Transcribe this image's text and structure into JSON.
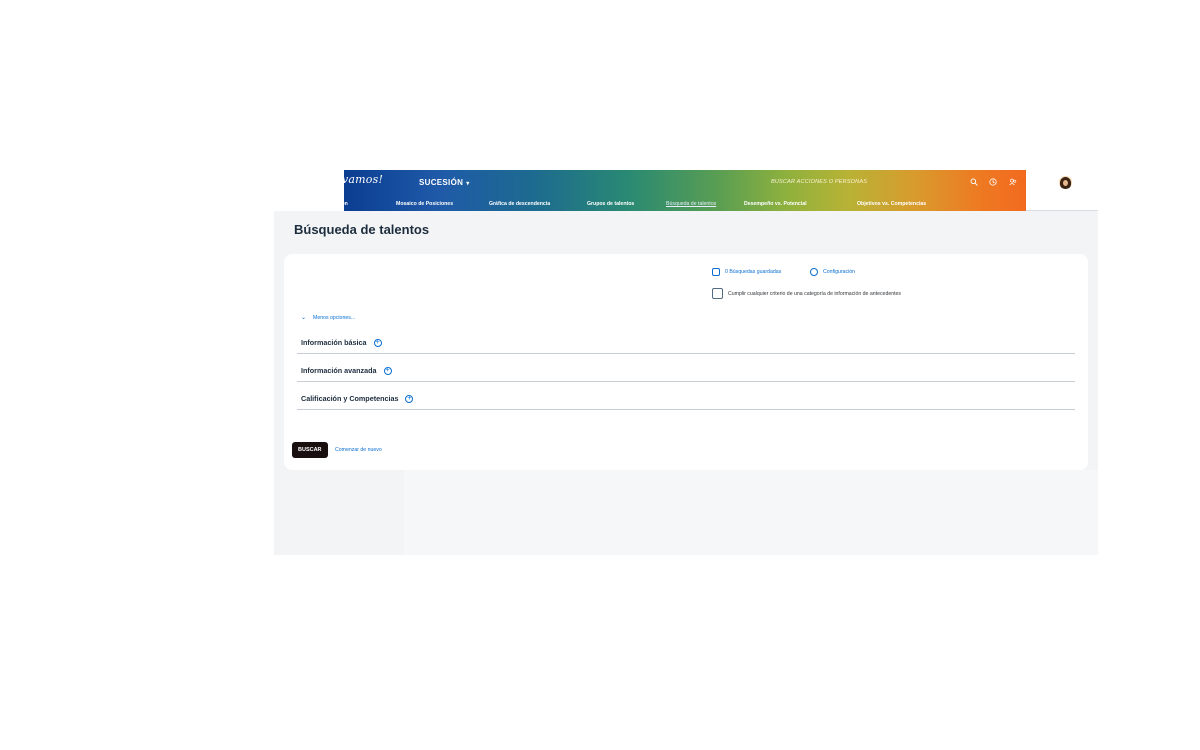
{
  "header": {
    "logo_text": "vamos!",
    "module": "SUCESIÓN",
    "search_placeholder": "BUSCAR ACCIONES O PERSONAS",
    "gradient_colors": [
      "#0b3d91",
      "#2a8a72",
      "#8fb13d",
      "#d99a2d",
      "#f26a1f"
    ],
    "icons": [
      "search-icon",
      "clock-icon",
      "people-icon",
      "avatar"
    ]
  },
  "nav": {
    "items": [
      {
        "label": "e sucesión"
      },
      {
        "label": "Mosaico de Posiciones"
      },
      {
        "label": "Gráfica de descendencia"
      },
      {
        "label": "Grupos de talentos"
      },
      {
        "label": "Búsqueda de talentos"
      },
      {
        "label": "Desempeño vs. Potencial"
      },
      {
        "label": "Objetivos vs. Competencias"
      }
    ],
    "active": "Búsqueda de talentos"
  },
  "page": {
    "title": "Búsqueda de talentos"
  },
  "card": {
    "saved_searches": "0 Búsquedas guardadas",
    "configuration": "Configuración",
    "criterion_checkbox": "Cumplir cualquier criterio de una categoría de información de antecedentes",
    "criterion_checked": false,
    "less_options": "Menos opciones...",
    "sections": [
      {
        "label": "Información básica"
      },
      {
        "label": "Información avanzada"
      },
      {
        "label": "Calificación y Competencias"
      }
    ],
    "search_button": "BUSCAR",
    "restart_link": "Comenzar de nuevo"
  },
  "colors": {
    "link": "#0a6ed1",
    "primary_button": "#1a0f0f",
    "background": "#f3f4f6"
  }
}
